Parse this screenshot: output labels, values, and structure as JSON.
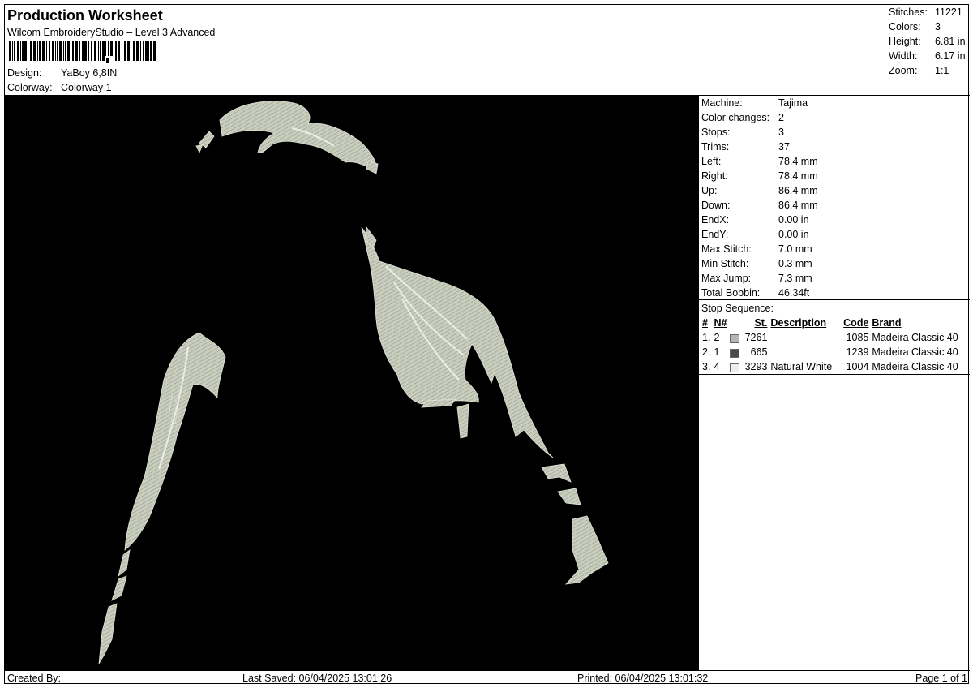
{
  "header": {
    "title": "Production Worksheet",
    "subtitle": "Wilcom EmbroideryStudio – Level 3 Advanced",
    "barcode_icon": "barcode-icon",
    "design_label": "Design:",
    "design_value": "YaBoy 6,8IN",
    "colorway_label": "Colorway:",
    "colorway_value": "Colorway 1"
  },
  "summary": [
    {
      "label": "Stitches:",
      "value": "11221"
    },
    {
      "label": "Colors:",
      "value": "3"
    },
    {
      "label": "Height:",
      "value": "6.81 in"
    },
    {
      "label": "Width:",
      "value": "6.17 in"
    },
    {
      "label": "Zoom:",
      "value": "1:1"
    }
  ],
  "machine_info": [
    {
      "label": "Machine:",
      "value": "Tajima"
    },
    {
      "label": "Color changes:",
      "value": "2"
    },
    {
      "label": "Stops:",
      "value": "3"
    },
    {
      "label": "Trims:",
      "value": "37"
    },
    {
      "label": "Left:",
      "value": "78.4 mm"
    },
    {
      "label": "Right:",
      "value": "78.4 mm"
    },
    {
      "label": "Up:",
      "value": "86.4 mm"
    },
    {
      "label": "Down:",
      "value": "86.4 mm"
    },
    {
      "label": "EndX:",
      "value": "0.00 in"
    },
    {
      "label": "EndY:",
      "value": "0.00 in"
    },
    {
      "label": "Max Stitch:",
      "value": "7.0 mm"
    },
    {
      "label": "Min Stitch:",
      "value": "0.3 mm"
    },
    {
      "label": "Max Jump:",
      "value": "7.3 mm"
    },
    {
      "label": "Total Bobbin:",
      "value": "46.34ft"
    }
  ],
  "stop_sequence": {
    "label": "Stop Sequence:",
    "headers": {
      "num": "#",
      "needle": "N#",
      "stitches": "St.",
      "description": "Description",
      "code": "Code",
      "brand": "Brand"
    },
    "rows": [
      {
        "num": "1.",
        "needle": "2",
        "color": "#b6b6b0",
        "stitches": "7261",
        "description": "",
        "code": "1085",
        "brand": "Madeira Classic 40"
      },
      {
        "num": "2.",
        "needle": "1",
        "color": "#4a4a4a",
        "stitches": "665",
        "description": "",
        "code": "1239",
        "brand": "Madeira Classic 40"
      },
      {
        "num": "3.",
        "needle": "4",
        "color": "#ecedf0",
        "stitches": "3293",
        "description": "Natural White",
        "code": "1004",
        "brand": "Madeira Classic 40"
      }
    ]
  },
  "design_view": {
    "background": "#000000",
    "thread_color": "#c8cdbd"
  },
  "footer": {
    "created_by": "Created By:",
    "last_saved": "Last Saved: 06/04/2025 13:01:26",
    "printed": "Printed: 06/04/2025 13:01:32",
    "page": "Page 1 of 1"
  }
}
